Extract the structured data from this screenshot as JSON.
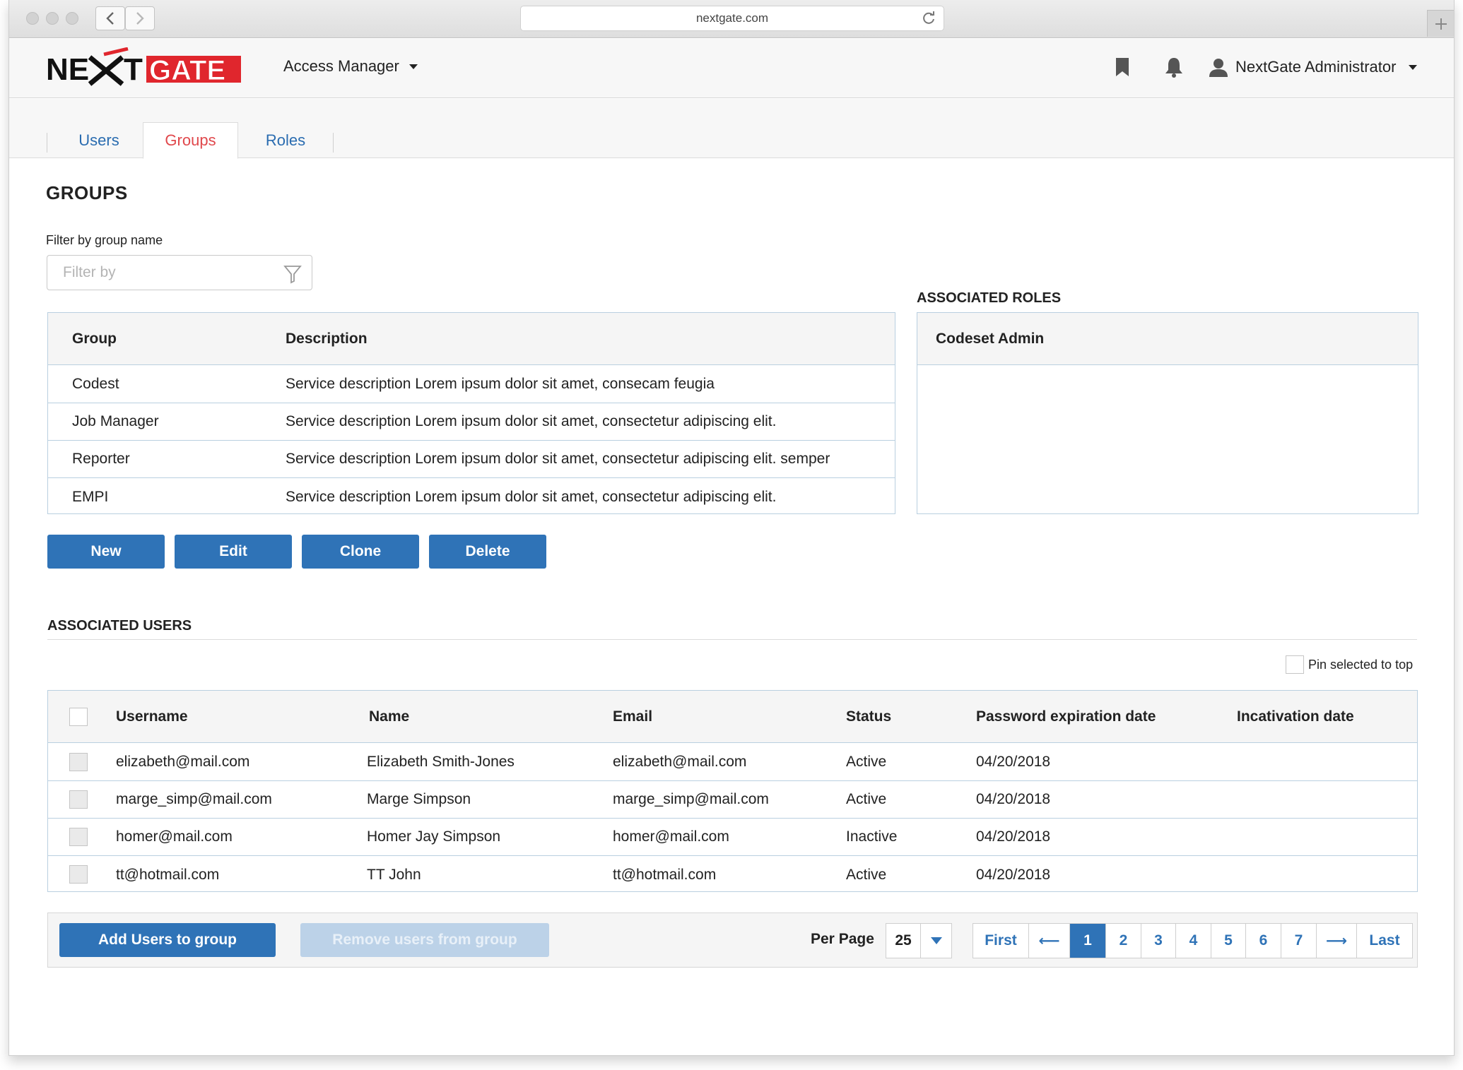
{
  "browser": {
    "url": "nextgate.com"
  },
  "header": {
    "logo_text": "NEXTGATE",
    "app_menu": "Access Manager",
    "user_menu": "NextGate Administrator"
  },
  "tabs": [
    {
      "label": "Users"
    },
    {
      "label": "Groups"
    },
    {
      "label": "Roles"
    }
  ],
  "groups": {
    "title": "GROUPS",
    "filter_label": "Filter by group name",
    "filter_placeholder": "Filter by",
    "columns": [
      "Group",
      "Description"
    ],
    "rows": [
      {
        "group": "Codest",
        "description": "Service description Lorem ipsum dolor sit amet, consecam feugia"
      },
      {
        "group": "Job Manager",
        "description": "Service description Lorem ipsum dolor sit amet, consectetur adipiscing elit."
      },
      {
        "group": "Reporter",
        "description": "Service description Lorem ipsum dolor sit amet, consectetur adipiscing elit. semper"
      },
      {
        "group": "EMPI",
        "description": "Service description Lorem ipsum dolor sit amet, consectetur adipiscing elit."
      }
    ],
    "buttons": {
      "new": "New",
      "edit": "Edit",
      "clone": "Clone",
      "delete": "Delete"
    }
  },
  "roles": {
    "title": "ASSOCIATED ROLES",
    "header": "Codeset Admin"
  },
  "users": {
    "title": "ASSOCIATED USERS",
    "pin_label": "Pin selected to top",
    "columns": [
      "Username",
      "Name",
      "Email",
      "Status",
      "Password expiration date",
      "Incativation date"
    ],
    "rows": [
      {
        "username": "elizabeth@mail.com",
        "name": "Elizabeth Smith-Jones",
        "email": "elizabeth@mail.com",
        "status": "Active",
        "pwd_exp": "04/20/2018",
        "inactivation": ""
      },
      {
        "username": "marge_simp@mail.com",
        "name": "Marge Simpson",
        "email": "marge_simp@mail.com",
        "status": "Active",
        "pwd_exp": "04/20/2018",
        "inactivation": ""
      },
      {
        "username": "homer@mail.com",
        "name": "Homer Jay Simpson",
        "email": "homer@mail.com",
        "status": "Inactive",
        "pwd_exp": "04/20/2018",
        "inactivation": ""
      },
      {
        "username": "tt@hotmail.com",
        "name": "TT John",
        "email": "tt@hotmail.com",
        "status": "Active",
        "pwd_exp": "04/20/2018",
        "inactivation": ""
      }
    ],
    "add_button": "Add Users to group",
    "remove_button": "Remove users from group",
    "per_page_label": "Per Page",
    "per_page_value": "25",
    "pager": {
      "first": "First",
      "prev": "⟵",
      "pages": [
        "1",
        "2",
        "3",
        "4",
        "5",
        "6",
        "7"
      ],
      "current": "1",
      "next": "⟶",
      "last": "Last"
    }
  },
  "colors": {
    "primary": "#2f73b7",
    "tab_active": "#e0484c",
    "logo_red": "#e0262d"
  }
}
